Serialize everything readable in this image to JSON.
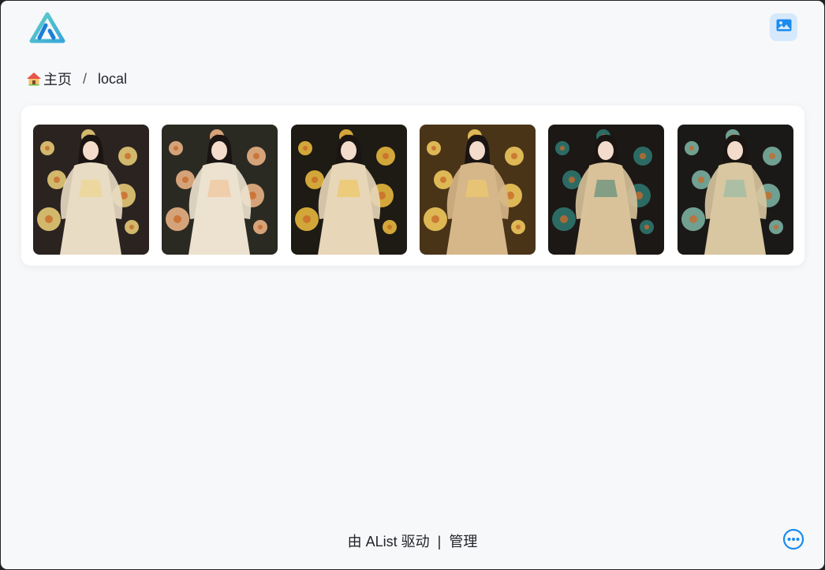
{
  "header": {
    "logo_icon": "alist-logo-icon",
    "view_toggle_icon": "image-icon"
  },
  "breadcrumb": {
    "home_icon": "house-icon",
    "home_label": "主页",
    "separator": "/",
    "current": "local"
  },
  "gallery": {
    "items": [
      {
        "name": "image-1",
        "palette": [
          "#2a2320",
          "#f0d27a",
          "#e8dcc4"
        ]
      },
      {
        "name": "image-2",
        "palette": [
          "#2b2a22",
          "#f3b98a",
          "#ece2cf"
        ]
      },
      {
        "name": "image-3",
        "palette": [
          "#1e1a14",
          "#f2c040",
          "#e7d6b8"
        ]
      },
      {
        "name": "image-4",
        "palette": [
          "#4a3418",
          "#f7d060",
          "#d6b78a"
        ]
      },
      {
        "name": "image-5",
        "palette": [
          "#1c1816",
          "#2f7a72",
          "#d9c29a"
        ]
      },
      {
        "name": "image-6",
        "palette": [
          "#1b1917",
          "#7fb8a8",
          "#d8c7a0"
        ]
      }
    ]
  },
  "footer": {
    "powered_by": "由 AList 驱动",
    "separator": "|",
    "manage": "管理",
    "more_icon": "more-dots-icon"
  },
  "colors": {
    "accent": "#1a8cf0",
    "background": "#f7f8fa",
    "toggle_bg": "#d6e9fb"
  }
}
